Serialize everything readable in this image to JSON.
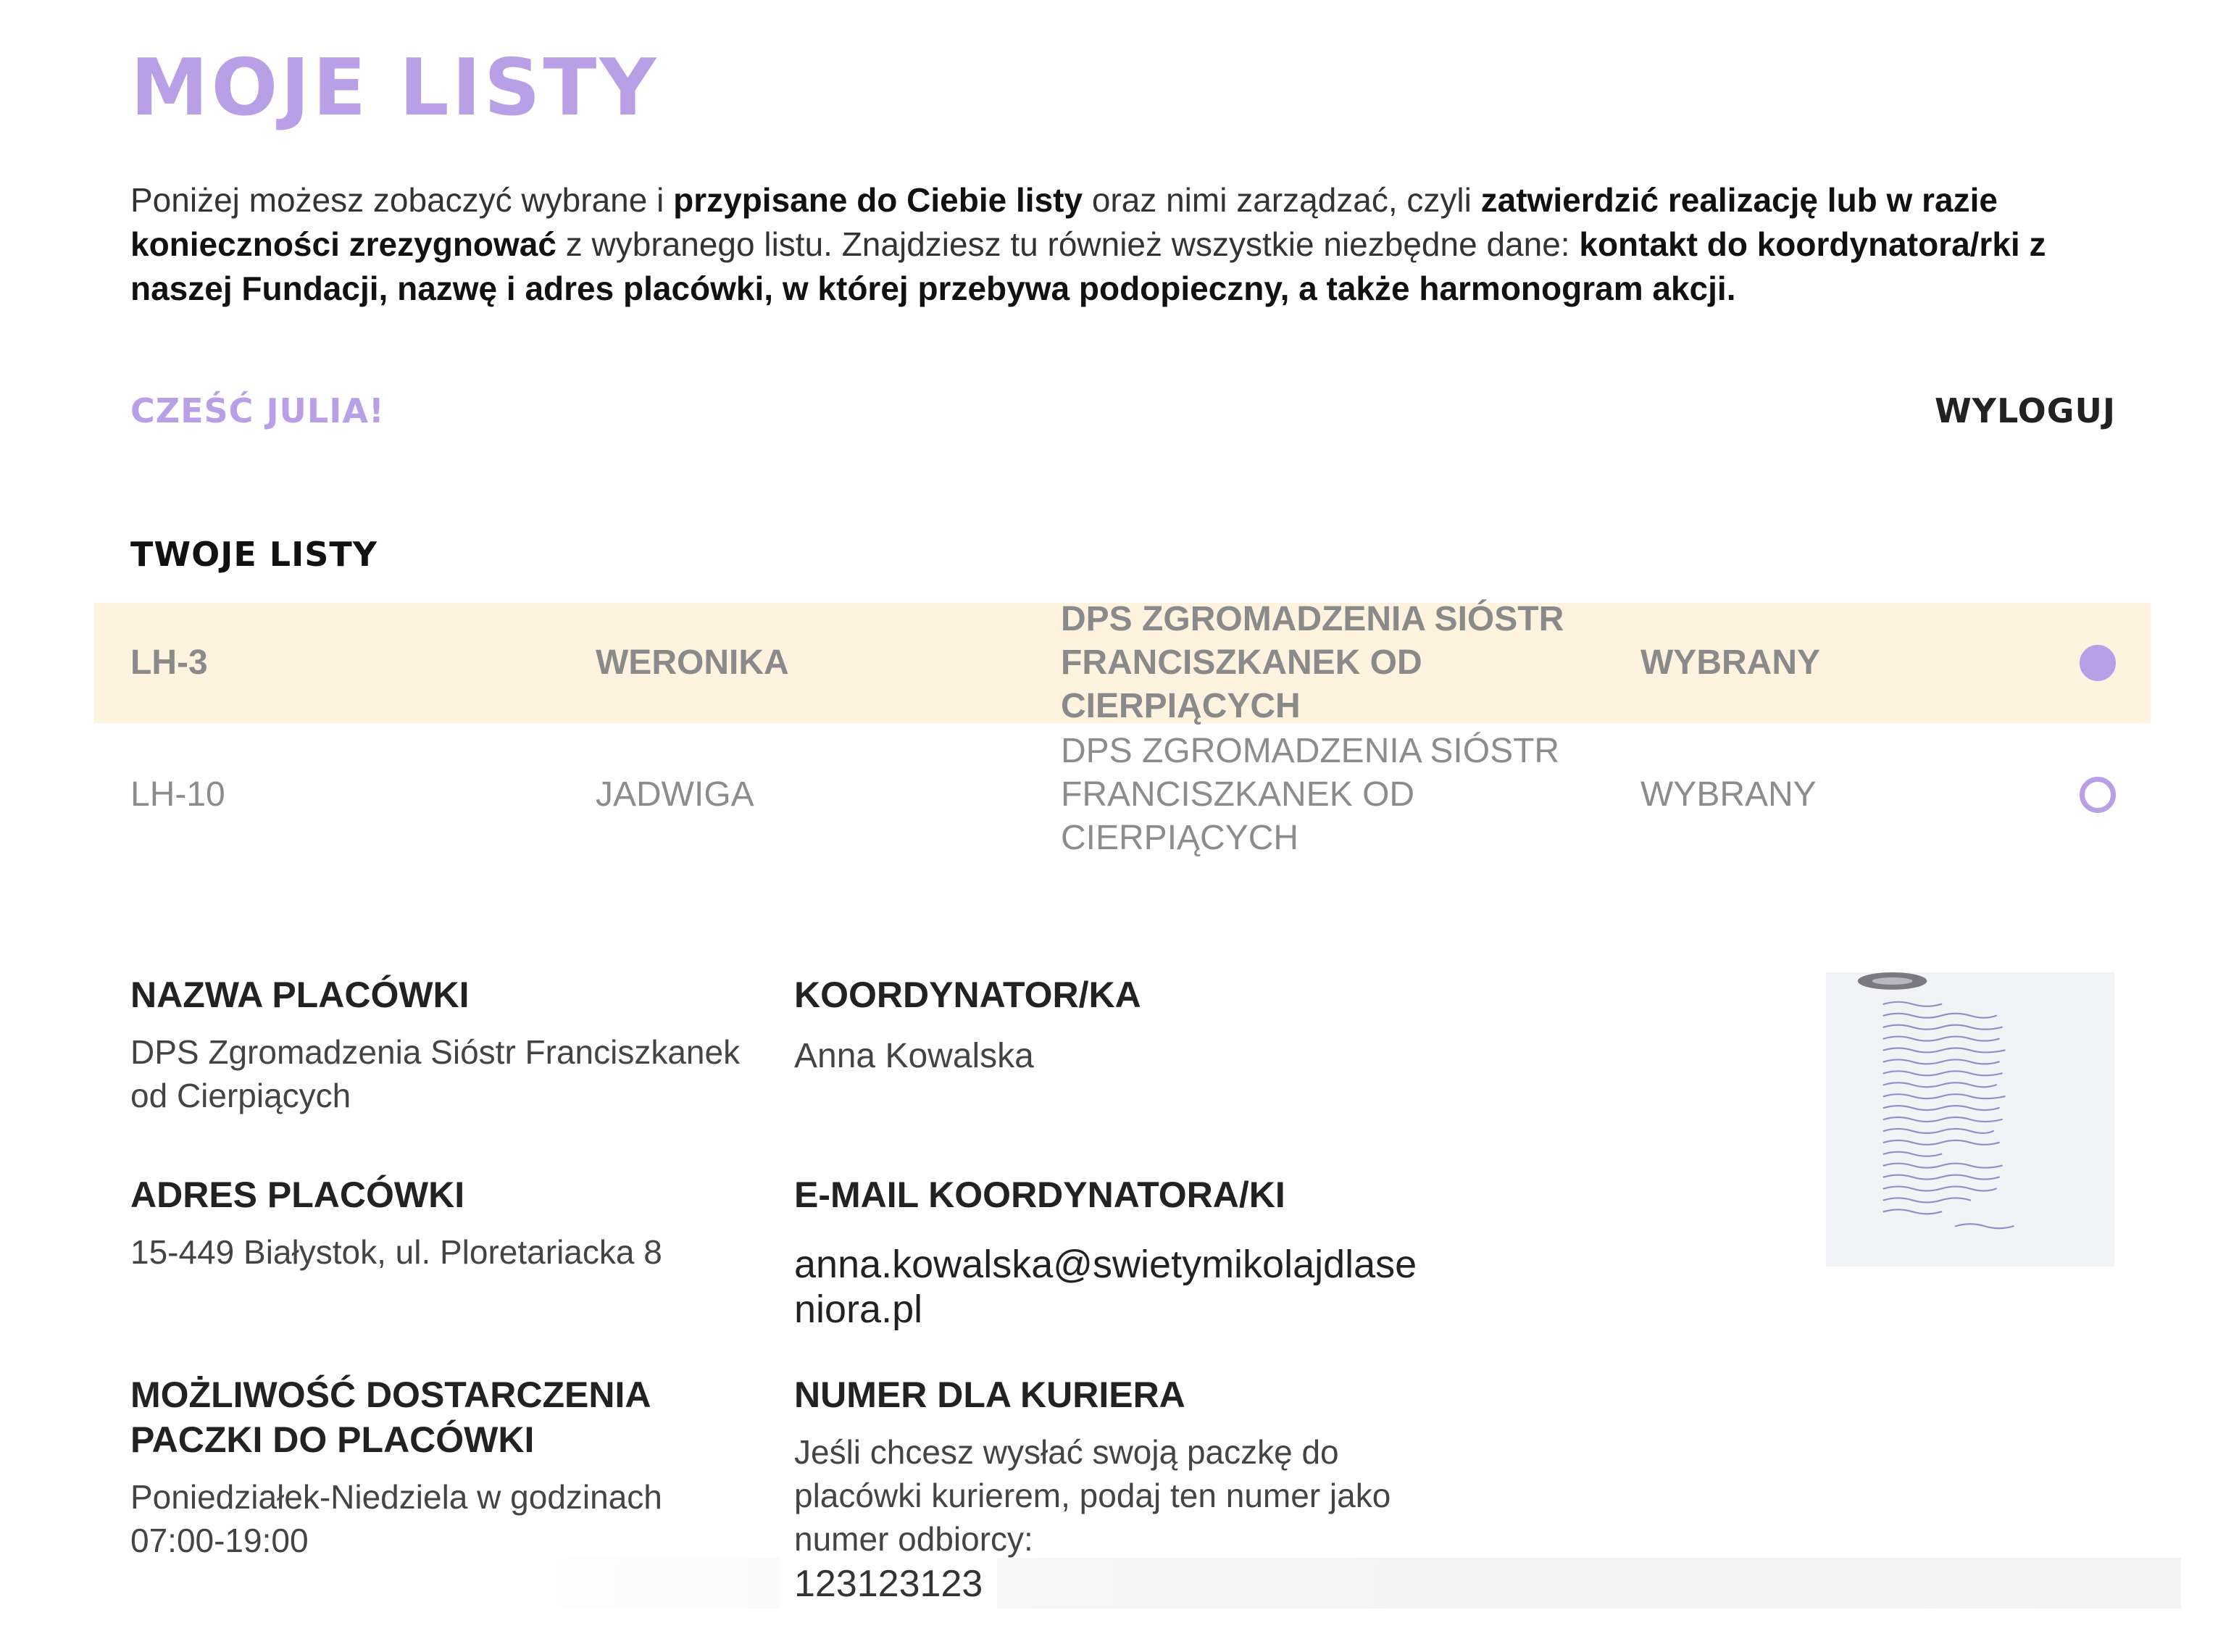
{
  "header": {
    "title": "MOJE LISTY",
    "intro": {
      "p1": "Poniżej możesz zobaczyć wybrane i ",
      "b1": "przypisane do Ciebie listy",
      "p2": " oraz nimi zarządzać, czyli ",
      "b2": "zatwierdzić realizację lub w razie konieczności zrezygnować",
      "p3": " z wybranego listu. Znajdziesz tu również wszystkie niezbędne dane: ",
      "b3": "kontakt do koordynatora/rki z naszej Fundacji, nazwę i adres placówki, w której przebywa podopieczny, a także harmonogram akcji."
    }
  },
  "user": {
    "greeting": "CZEŚĆ JULIA!",
    "logout_label": "WYLOGUJ"
  },
  "lists": {
    "title": "TWOJE LISTY",
    "rows": [
      {
        "code": "LH-3",
        "name": "WERONIKA",
        "place": "DPS ZGROMADZENIA SIÓSTR FRANCISZKANEK OD CIERPIĄCYCH",
        "status": "WYBRANY",
        "selected": true
      },
      {
        "code": "LH-10",
        "name": "JADWIGA",
        "place": "DPS ZGROMADZENIA SIÓSTR FRANCISZKANEK OD CIERPIĄCYCH",
        "status": "WYBRANY",
        "selected": false
      }
    ]
  },
  "details": {
    "facility_name": {
      "label": "NAZWA PLACÓWKI",
      "value": "DPS Zgromadzenia Sióstr Franciszkanek od Cierpiących"
    },
    "coordinator": {
      "label": "KOORDYNATOR/KA",
      "value": "Anna Kowalska"
    },
    "facility_address": {
      "label": "ADRES PLACÓWKI",
      "value": "15-449 Białystok, ul. Ploretariacka 8"
    },
    "coordinator_email": {
      "label": "E-MAIL KOORDYNATORA/KI",
      "value": "anna.kowalska@swietymikolajdlaseniora.pl"
    },
    "delivery": {
      "label": "MOŻLIWOŚĆ DOSTARCZENIA PACZKI DO PLACÓWKI",
      "value": "Poniedziałek-Niedziela w godzinach 07:00-19:00"
    },
    "courier": {
      "label": "NUMER DLA KURIERA",
      "value": "Jeśli chcesz wysłać swoją paczkę do placówki kurierem, podaj ten numer jako numer odbiorcy:",
      "number": "123123123"
    }
  },
  "colors": {
    "accent": "#b9a0e6",
    "selected_row_bg": "#fdf3df"
  },
  "icons": {
    "selected_radio": "radio-filled-icon",
    "unselected_radio": "radio-empty-icon"
  }
}
